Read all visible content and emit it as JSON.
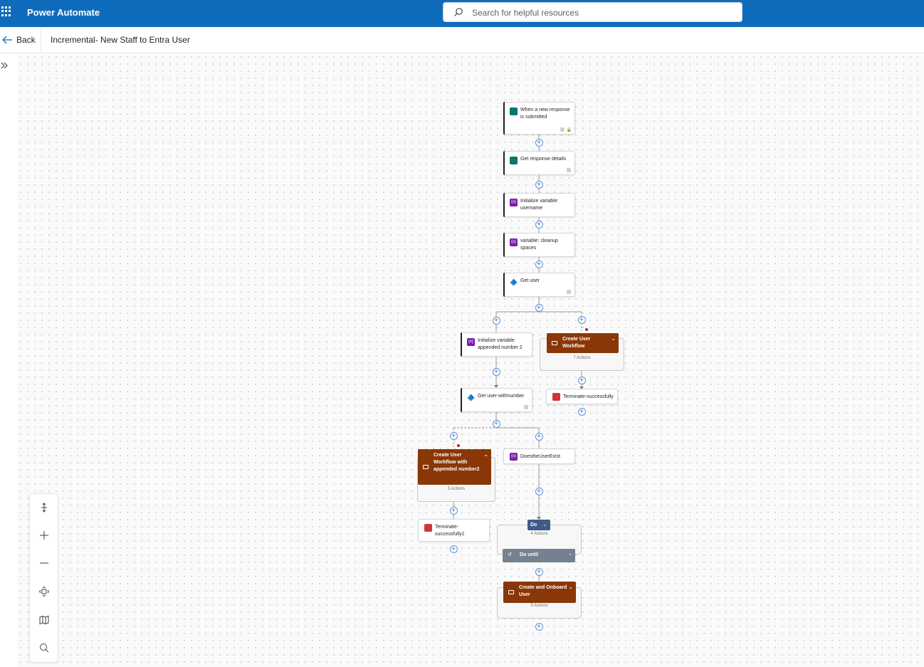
{
  "header": {
    "app_title": "Power Automate",
    "search_placeholder": "Search for helpful resources"
  },
  "subheader": {
    "back_label": "Back",
    "flow_title": "Incremental- New Staff to Entra User"
  },
  "nodes": {
    "trigger": "When a new response is submitted",
    "get_response": "Get response details",
    "init_username": "Initialize variable: username",
    "cleanup": "variable: cleanup spaces",
    "get_user": "Get user",
    "init_appended": "Initialize variable appended number 2",
    "get_user_number": "Get user-withnumber",
    "terminate1": "Terminate-successfully",
    "terminate2": "Terminate-successfully1",
    "does_exist": "DoestheUserExist"
  },
  "scopes": {
    "create_user_workflow": {
      "title": "Create User Workflow",
      "count": "7 Actions"
    },
    "create_user_appended": {
      "title": "Create User Workflow with appended number2",
      "count": "5 Actions"
    },
    "do_until": {
      "do_label": "Do",
      "count": "4 Actions",
      "until_label": "Do until"
    },
    "create_onboard": {
      "title": "Create and Onboard User",
      "count": "5 Actions"
    }
  },
  "tools": [
    "fit-height-icon",
    "zoom-in-icon",
    "zoom-out-icon",
    "fit-view-icon",
    "minimap-icon",
    "search-icon"
  ],
  "colors": {
    "header": "#0f6cbd",
    "scope": "#8a3707",
    "variable": "#7719aa",
    "forms": "#077568",
    "terminate": "#d13438",
    "do_until": "#74828f"
  }
}
